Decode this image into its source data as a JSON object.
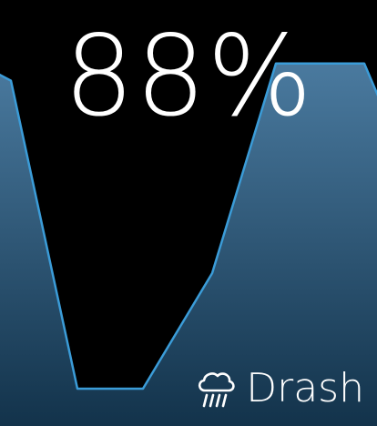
{
  "reading": {
    "value_label": "88%",
    "value": 88
  },
  "chart_data": {
    "type": "area",
    "x": [
      0,
      1,
      2,
      3,
      4,
      5,
      6
    ],
    "y": [
      0.82,
      0.1,
      0.1,
      0.37,
      0.86,
      0.86,
      0.76
    ],
    "title": "",
    "xlabel": "",
    "ylabel": "",
    "grid": false,
    "colors": {
      "line": "#3b9cd8",
      "fill_top": "#4a7a9f",
      "fill_bottom": "#12324a"
    }
  },
  "brand": {
    "icon": "cloud-rain-icon",
    "label": "Drash"
  }
}
